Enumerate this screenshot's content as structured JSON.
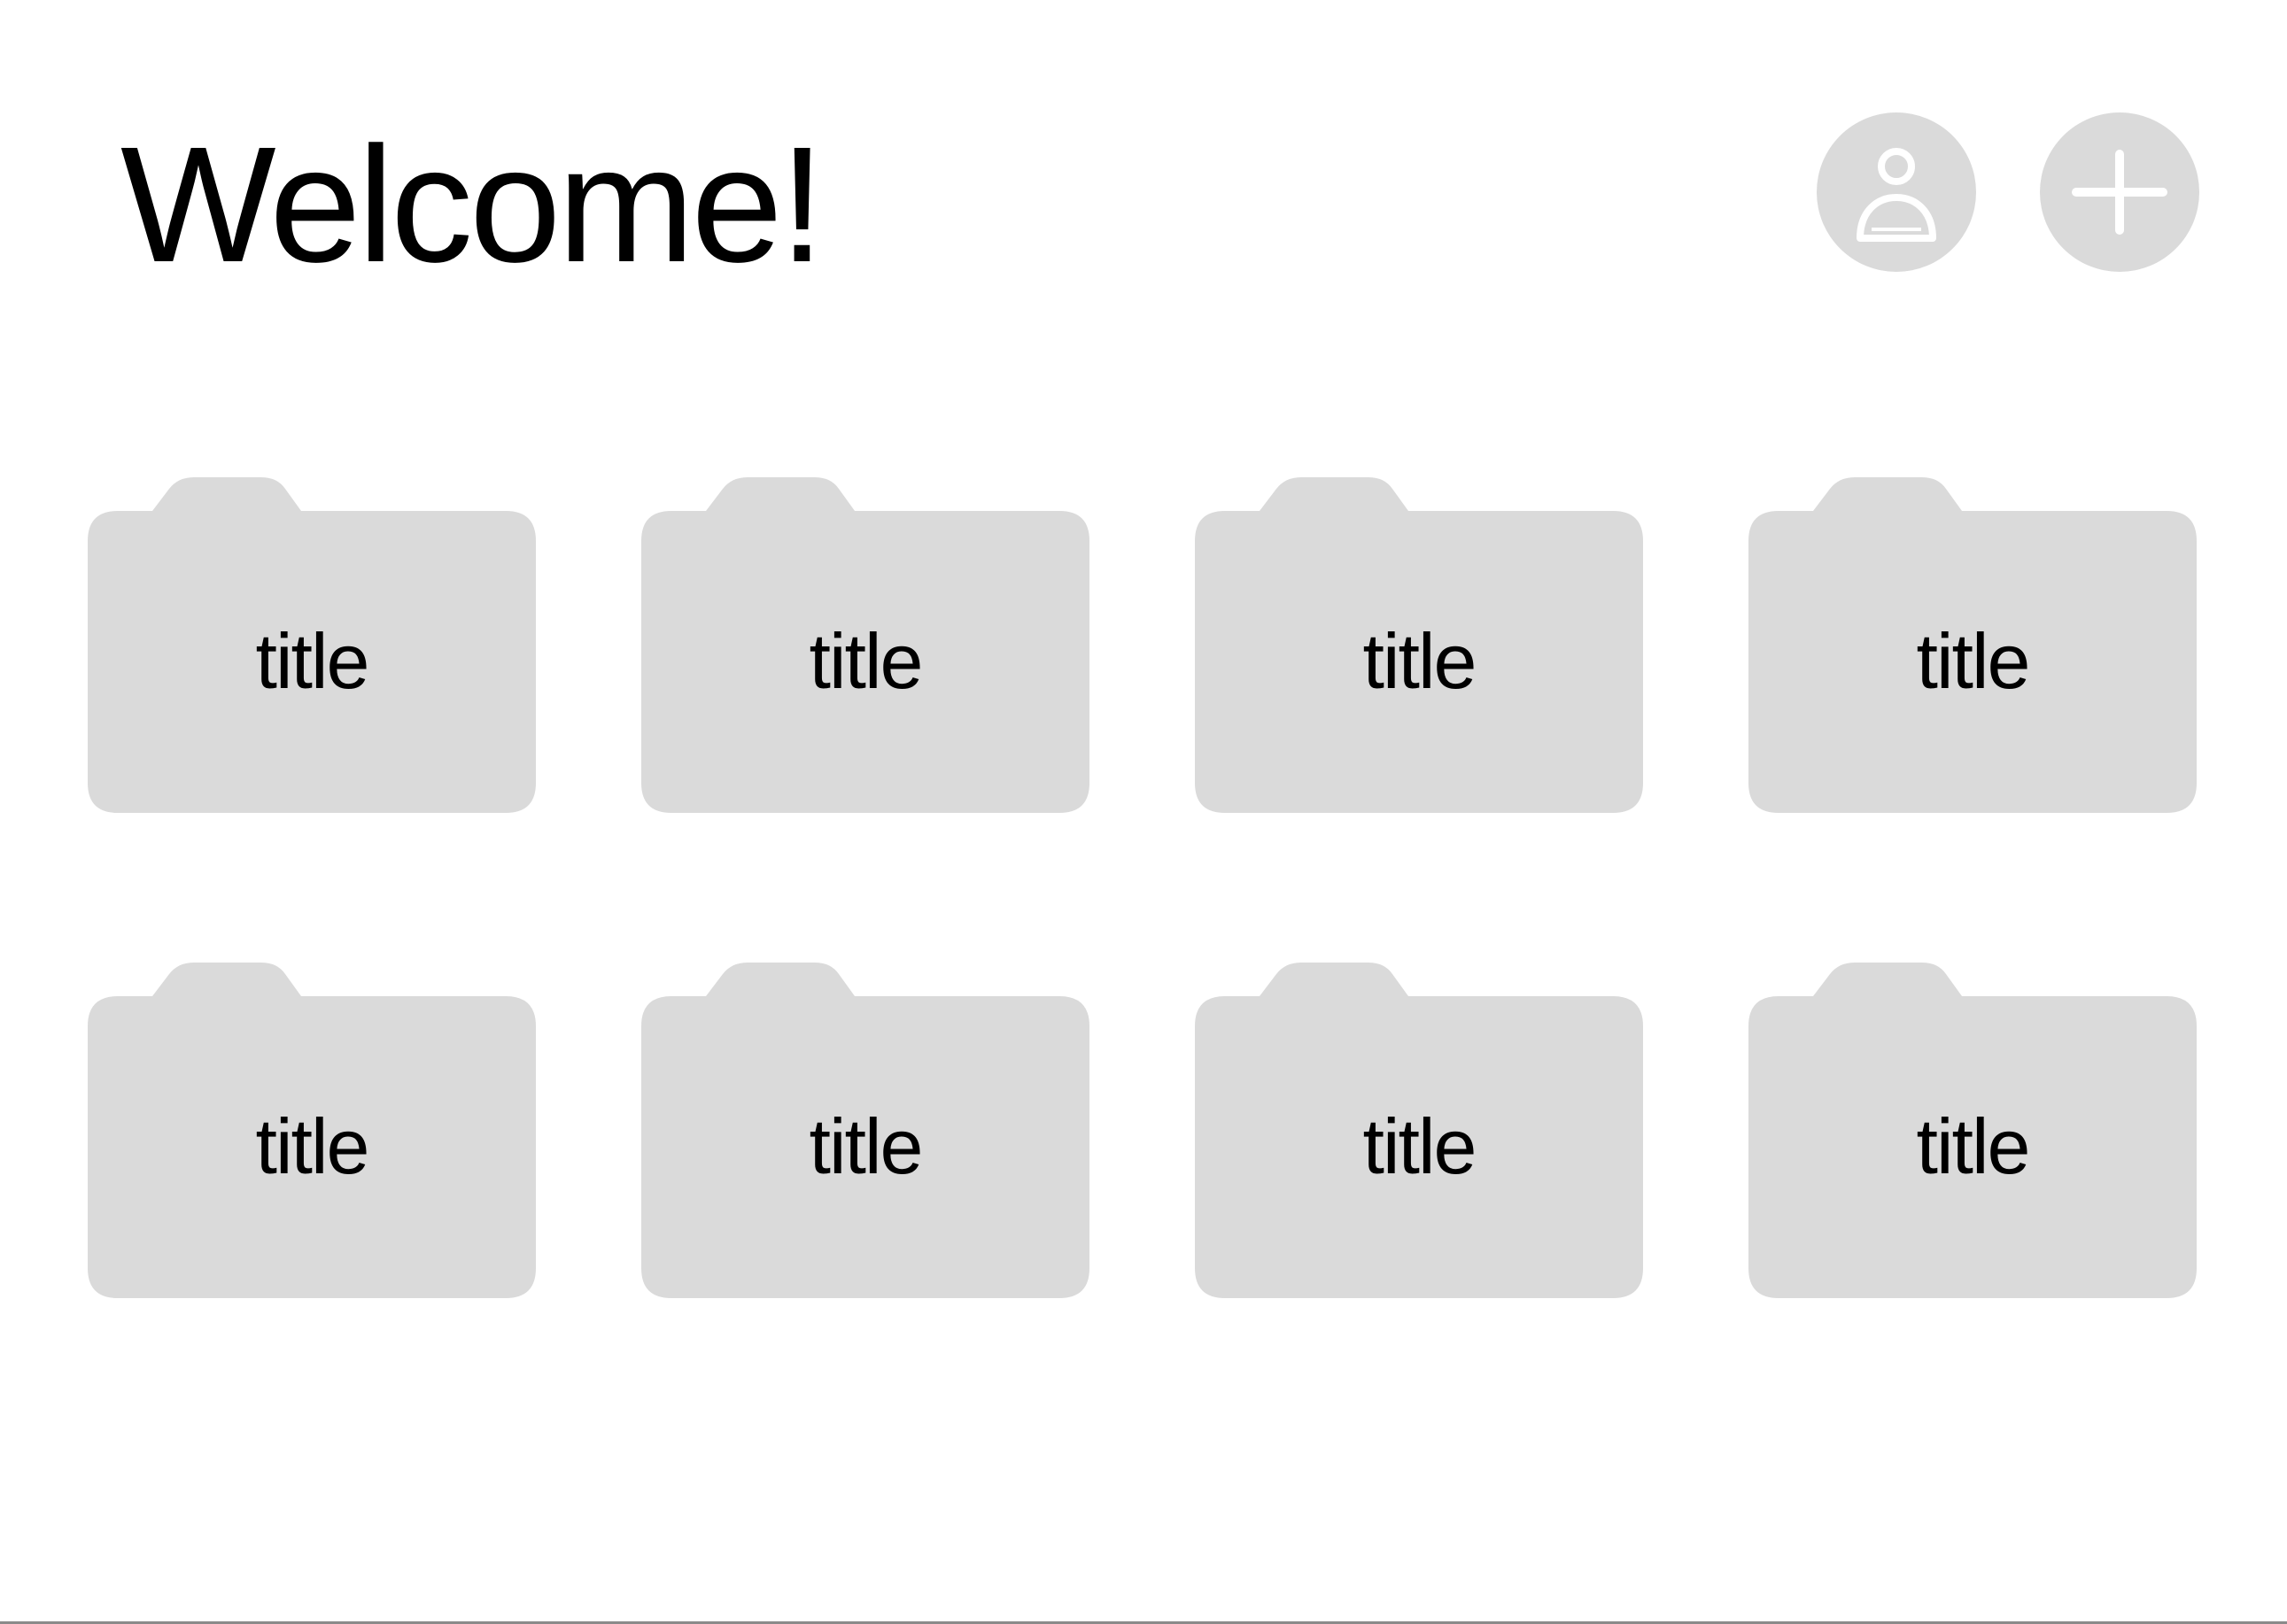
{
  "header": {
    "title": "Welcome!",
    "actions": [
      {
        "id": "profile",
        "icon": "user-icon"
      },
      {
        "id": "add",
        "icon": "plus-icon"
      }
    ]
  },
  "folders": [
    {
      "title": "title"
    },
    {
      "title": "title"
    },
    {
      "title": "title"
    },
    {
      "title": "title"
    },
    {
      "title": "title"
    },
    {
      "title": "title"
    },
    {
      "title": "title"
    },
    {
      "title": "title"
    }
  ],
  "colors": {
    "background": "#ffffff",
    "folder_fill": "#dadada",
    "button_fill": "#dadada",
    "icon_stroke": "#ffffff",
    "text": "#000000"
  }
}
